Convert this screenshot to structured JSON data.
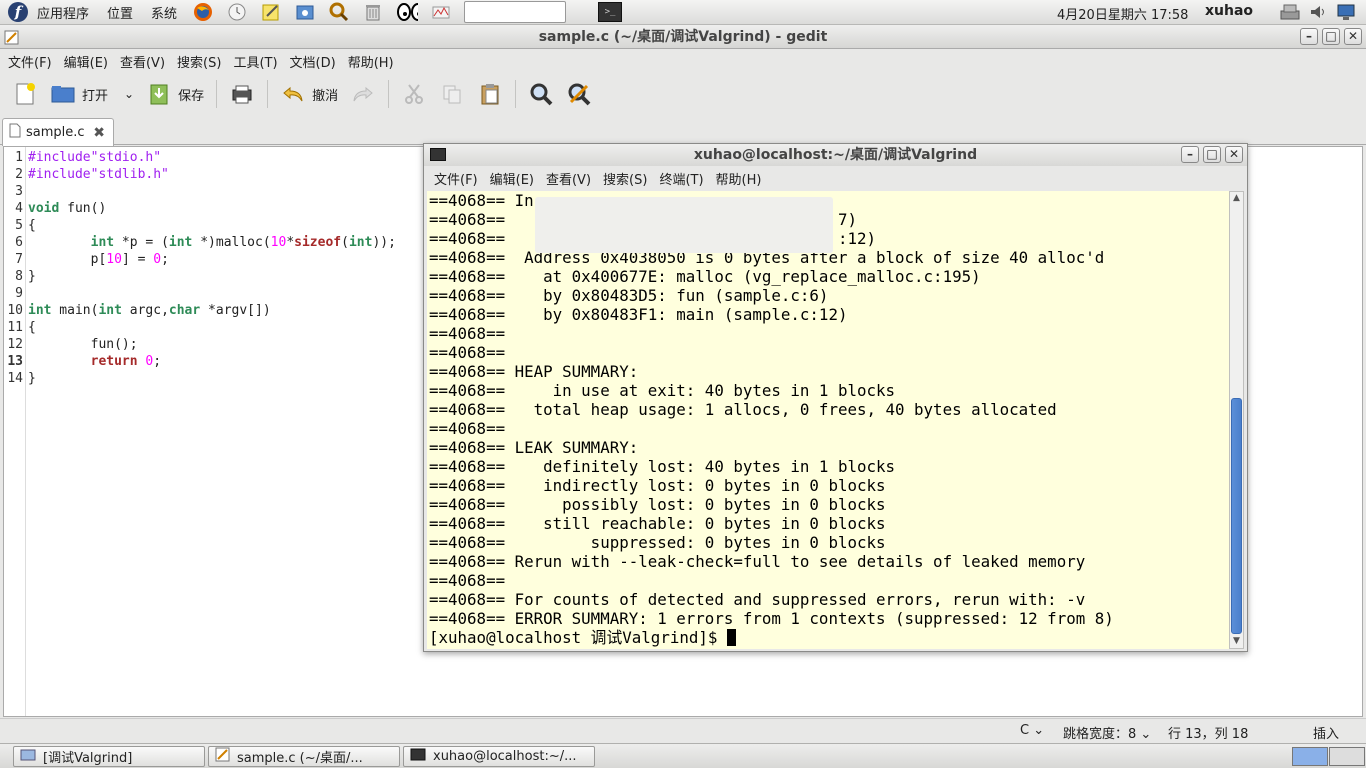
{
  "top_panel": {
    "menus": [
      "应用程序",
      "位置",
      "系统"
    ],
    "clock": "4月20日星期六 17:58",
    "username": "xuhao"
  },
  "gedit": {
    "title": "sample.c (~/桌面/调试Valgrind) - gedit",
    "menus": [
      "文件(F)",
      "编辑(E)",
      "查看(V)",
      "搜索(S)",
      "工具(T)",
      "文档(D)",
      "帮助(H)"
    ],
    "toolbar": {
      "open_label": "打开",
      "save_label": "保存",
      "undo_label": "撤消"
    },
    "tab_label": "sample.c",
    "line_numbers": [
      "1",
      "2",
      "3",
      "4",
      "5",
      "6",
      "7",
      "8",
      "9",
      "10",
      "11",
      "12",
      "13",
      "14"
    ],
    "status": {
      "language": "C",
      "tab_width": "跳格宽度：8",
      "position": "行 13，列 18",
      "mode": "插入"
    }
  },
  "code_lines": [
    [
      {
        "t": "#include\"stdio.h\"",
        "c": "pp"
      }
    ],
    [
      {
        "t": "#include\"stdlib.h\"",
        "c": "pp"
      }
    ],
    [],
    [
      {
        "t": "void",
        "c": "kw-type"
      },
      {
        "t": " fun()",
        "c": ""
      }
    ],
    [
      {
        "t": "{",
        "c": ""
      }
    ],
    [
      {
        "t": "        ",
        "c": ""
      },
      {
        "t": "int",
        "c": "kw-type"
      },
      {
        "t": " *p = (",
        "c": ""
      },
      {
        "t": "int",
        "c": "kw-type"
      },
      {
        "t": " *)malloc(",
        "c": ""
      },
      {
        "t": "10",
        "c": "num"
      },
      {
        "t": "*",
        "c": ""
      },
      {
        "t": "sizeof",
        "c": "kw-ctl"
      },
      {
        "t": "(",
        "c": ""
      },
      {
        "t": "int",
        "c": "kw-type"
      },
      {
        "t": "));",
        "c": ""
      }
    ],
    [
      {
        "t": "        p[",
        "c": ""
      },
      {
        "t": "10",
        "c": "num"
      },
      {
        "t": "] = ",
        "c": ""
      },
      {
        "t": "0",
        "c": "num"
      },
      {
        "t": ";",
        "c": ""
      }
    ],
    [
      {
        "t": "}",
        "c": ""
      }
    ],
    [],
    [
      {
        "t": "int",
        "c": "kw-type"
      },
      {
        "t": " main(",
        "c": ""
      },
      {
        "t": "int",
        "c": "kw-type"
      },
      {
        "t": " argc,",
        "c": ""
      },
      {
        "t": "char",
        "c": "kw-type"
      },
      {
        "t": " *argv[])",
        "c": ""
      }
    ],
    [
      {
        "t": "{",
        "c": ""
      }
    ],
    [
      {
        "t": "        fun();",
        "c": ""
      }
    ],
    [
      {
        "t": "        ",
        "c": ""
      },
      {
        "t": "return",
        "c": "kw-ctl"
      },
      {
        "t": " ",
        "c": ""
      },
      {
        "t": "0",
        "c": "num"
      },
      {
        "t": ";",
        "c": ""
      }
    ],
    [
      {
        "t": "}",
        "c": ""
      }
    ]
  ],
  "terminal": {
    "title": "xuhao@localhost:~/桌面/调试Valgrind",
    "menus": [
      "文件(F)",
      "编辑(E)",
      "查看(V)",
      "搜索(S)",
      "终端(T)",
      "帮助(H)"
    ],
    "lines": [
      "==4068== In",
      "==4068==                                   7)",
      "==4068==                                   :12)",
      "==4068==  Address 0x4038050 is 0 bytes after a block of size 40 alloc'd",
      "==4068==    at 0x400677E: malloc (vg_replace_malloc.c:195)",
      "==4068==    by 0x80483D5: fun (sample.c:6)",
      "==4068==    by 0x80483F1: main (sample.c:12)",
      "==4068==",
      "==4068==",
      "==4068== HEAP SUMMARY:",
      "==4068==     in use at exit: 40 bytes in 1 blocks",
      "==4068==   total heap usage: 1 allocs, 0 frees, 40 bytes allocated",
      "==4068==",
      "==4068== LEAK SUMMARY:",
      "==4068==    definitely lost: 40 bytes in 1 blocks",
      "==4068==    indirectly lost: 0 bytes in 0 blocks",
      "==4068==      possibly lost: 0 bytes in 0 blocks",
      "==4068==    still reachable: 0 bytes in 0 blocks",
      "==4068==         suppressed: 0 bytes in 0 blocks",
      "==4068== Rerun with --leak-check=full to see details of leaked memory",
      "==4068==",
      "==4068== For counts of detected and suppressed errors, rerun with: -v",
      "==4068== ERROR SUMMARY: 1 errors from 1 contexts (suppressed: 12 from 8)"
    ],
    "prompt": "[xuhao@localhost 调试Valgrind]$ "
  },
  "taskbar": [
    {
      "label": "[调试Valgrind]",
      "icon": "folder-icon"
    },
    {
      "label": "sample.c (~/桌面/...",
      "icon": "text-editor-icon"
    },
    {
      "label": "xuhao@localhost:~/...",
      "icon": "terminal-icon"
    }
  ],
  "colors": {
    "terminal_bg": "#ffffdd",
    "scroll_thumb": "#4a7fcc",
    "preprocessor": "#a020f0",
    "type_keyword": "#2e8b57",
    "control_keyword": "#a52a2a",
    "literal": "#ff00ff"
  }
}
